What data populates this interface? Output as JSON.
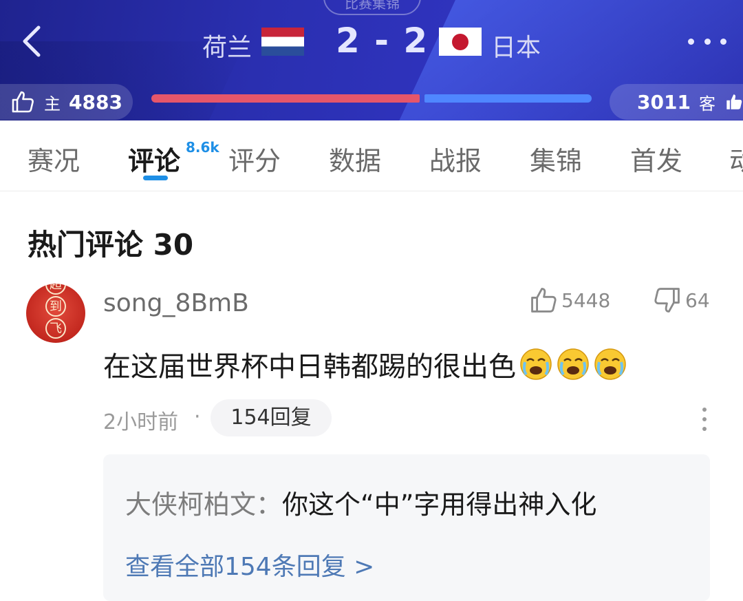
{
  "header": {
    "top_pill": "比赛集锦",
    "home_team": "荷兰",
    "away_team": "日本",
    "score": "2 - 2",
    "home_vote_label": "主",
    "home_votes": "4883",
    "away_vote_label": "客",
    "away_votes": "3011",
    "home_vote_share": 0.619,
    "colors": {
      "home_bar": "#e5566a",
      "away_bar": "#4f87ff",
      "header_bg": "#2a2fb0"
    }
  },
  "tabs": {
    "items": [
      "赛况",
      "评论",
      "评分",
      "数据",
      "战报",
      "集锦",
      "首发",
      "动"
    ],
    "active": "评论",
    "comment_badge": "8.6k",
    "accent": "#1e8fe6"
  },
  "section": {
    "title": "热门评论 30"
  },
  "comment": {
    "avatar_chars": [
      "超",
      "到",
      "飞"
    ],
    "username": "song_8BmB",
    "likes": "5448",
    "dislikes": "64",
    "text": "在这届世界杯中日韩都踢的很出色",
    "emoji": [
      "crying-face",
      "crying-face",
      "crying-face"
    ],
    "time": "2小时前",
    "separator": "·",
    "reply_count": "154回复"
  },
  "reply_preview": {
    "author": "大侠柯柏文：",
    "content": "你这个“中”字用得出神入化",
    "view_all": "查看全部154条回复 >"
  }
}
